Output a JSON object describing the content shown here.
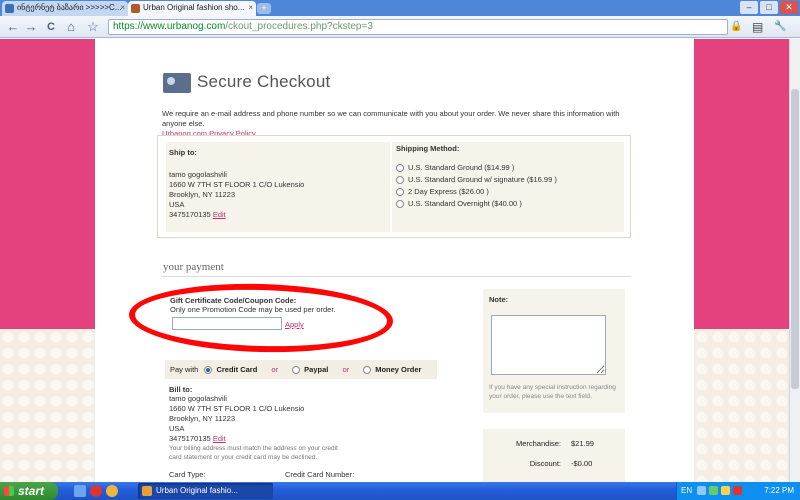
{
  "browser": {
    "tabs": [
      {
        "label": "ინტერნეტ ბაზარი >>>>>C..."
      },
      {
        "label": "Urban Original fashion sho..."
      }
    ],
    "new_tab": "+",
    "window_buttons": {
      "minimize": "–",
      "maximize": "□",
      "close": "✕"
    },
    "nav": {
      "back": "←",
      "forward": "→",
      "reload": "C",
      "home": "⌂",
      "star": "☆"
    },
    "url": {
      "scheme": "https://",
      "domain": "www.urbanog.com",
      "path": "/ckout_procedures.php?ckstep=3"
    },
    "toolbar_right": {
      "lock": "🔒",
      "page": "▤",
      "tools": "🔧"
    }
  },
  "page": {
    "title": "Secure Checkout",
    "intro": "We require an e-mail address and phone number so we can communicate with you about your order. We never share this information with anyone else.",
    "privacy_link": "Urbanog.com Privacy Policy",
    "ship_to": {
      "label": "Ship to:",
      "name": "tamo gogolashvili",
      "street": "1660 W 7TH ST FLOOR 1 C/O Lukensio",
      "city": "Brooklyn, NY 11223",
      "country": "USA",
      "phone": "3475170135",
      "edit": "Edit"
    },
    "shipping": {
      "label": "Shipping Method:",
      "options": [
        {
          "label": "U.S. Standard Ground ($14.99 )"
        },
        {
          "label": "U.S. Standard Ground w/ signature ($16.99 )"
        },
        {
          "label": "2 Day Express ($26.00 )"
        },
        {
          "label": "U.S. Standard Overnight ($40.00 )"
        }
      ]
    },
    "your_payment": "your payment",
    "coupon": {
      "label": "Gift Certificate Code/Coupon Code:",
      "hint": "Only one Promotion Code may be used per order.",
      "value": "",
      "apply": "Apply"
    },
    "pay_with": {
      "label": "Pay with",
      "or": "or",
      "methods": [
        {
          "label": "Credit Card",
          "selected": true
        },
        {
          "label": "Paypal",
          "selected": false
        },
        {
          "label": "Money Order",
          "selected": false
        }
      ]
    },
    "bill_to": {
      "label": "Bill to:",
      "name": "tamo gogolashvili",
      "street": "1660 W 7TH ST FLOOR 1 C/O Lukensio",
      "city": "Brooklyn, NY 11223",
      "country": "USA",
      "phone": "3475170135",
      "edit": "Edit",
      "note": "Your billing address must match the address on your credit card statement or your credit card may be declined."
    },
    "card_type_label": "Card Type:",
    "card_number_label": "Credit Card Number:",
    "note": {
      "label": "Note:",
      "value": "",
      "help": "If you have any special instruction regarding your order, please use the text field."
    },
    "summary": {
      "merchandise_label": "Merchandise:",
      "merchandise_value": "$21.99",
      "discount_label": "Discount:",
      "discount_value": "-$0.00"
    }
  },
  "taskbar": {
    "start": "start",
    "active_item": "Urban Original fashio...",
    "lang": "EN",
    "clock": "7:22 PM"
  }
}
